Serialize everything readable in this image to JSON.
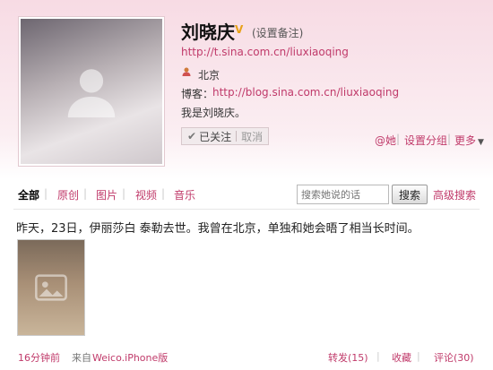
{
  "profile": {
    "name": "刘晓庆",
    "verified_badge": "V",
    "remark_link": "(设置备注)",
    "weibo_url": "http://t.sina.com.cn/liuxiaoqing",
    "location_icon": "person-pin-icon",
    "location": "北京",
    "blog_label": "博客：",
    "blog_url": "http://blog.sina.com.cn/liuxiaoqing",
    "bio": "我是刘晓庆。",
    "followed_label": "已关注",
    "cancel_label": "取消",
    "mention_label": "@她",
    "set_group_label": "设置分组",
    "more_label": "更多"
  },
  "tabs": [
    {
      "label": "全部",
      "active": true
    },
    {
      "label": "原创",
      "active": false
    },
    {
      "label": "图片",
      "active": false
    },
    {
      "label": "视频",
      "active": false
    },
    {
      "label": "音乐",
      "active": false
    }
  ],
  "search": {
    "placeholder": "搜索她说的话",
    "button_label": "搜索",
    "advanced_label": "高级搜索"
  },
  "post": {
    "text": "昨天，23日，伊丽莎白 泰勒去世。我曾在北京，单独和她会晤了相当长时间。",
    "time": "16分钟前",
    "source_prefix": "来自",
    "source": "Weico.iPhone版",
    "repost_label": "转发(15)",
    "favorite_label": "收藏",
    "comment_label": "评论(30)"
  },
  "colors": {
    "accent": "#c03a6a",
    "header_bg": "#f7dbe4",
    "verified": "#e8a21a"
  }
}
